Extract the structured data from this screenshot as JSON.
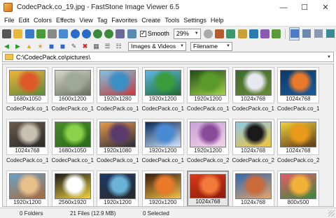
{
  "window": {
    "title": "CodecPack.co_19.jpg - FastStone Image Viewer 6.5"
  },
  "menu": [
    "File",
    "Edit",
    "Colors",
    "Effects",
    "View",
    "Tag",
    "Favorites",
    "Create",
    "Tools",
    "Settings",
    "Help"
  ],
  "toolbar": {
    "smooth_label": "Smooth",
    "smooth_checked": true,
    "zoom_value": "29%"
  },
  "browser": {
    "filter_value": "Images & Videos",
    "sort_value": "Filename",
    "path": "C:\\CodecPack.co\\pictures\\"
  },
  "thumbnails": [
    {
      "dim": "1680x1050",
      "name": "CodecPack.co_1",
      "colors": [
        "#f2b23a",
        "#e0582a",
        "#5c8a3a"
      ]
    },
    {
      "dim": "1600x1200",
      "name": "CodecPack.co_10",
      "colors": [
        "#d8d8c8",
        "#a0a898",
        "#6a7060"
      ]
    },
    {
      "dim": "1920x1280",
      "name": "CodecPack.co_11",
      "colors": [
        "#7cc4e8",
        "#3b8fc7",
        "#c83a3a"
      ]
    },
    {
      "dim": "1920x1200",
      "name": "CodecPack.co_12",
      "colors": [
        "#5db7e6",
        "#3a9c3a",
        "#1f6b2b"
      ]
    },
    {
      "dim": "1920x1200",
      "name": "CodecPack.co_13",
      "colors": [
        "#1f4d14",
        "#5a9a2a",
        "#9fd24a"
      ]
    },
    {
      "dim": "1024x768",
      "name": "CodecPack.co_14",
      "colors": [
        "#3a6a2a",
        "#e8e8f0",
        "#6a8a3a"
      ]
    },
    {
      "dim": "1024x768",
      "name": "CodecPack.co_15",
      "colors": [
        "#0a3a6a",
        "#e87a2a",
        "#1a5a9a"
      ]
    },
    {
      "dim": "1024x768",
      "name": "CodecPack.co_16",
      "colors": [
        "#6a5a4a",
        "#c8c0b0",
        "#2a2a2a"
      ]
    },
    {
      "dim": "1680x1050",
      "name": "CodecPack.co_17",
      "colors": [
        "#4a8a2a",
        "#8ad24a",
        "#2a6a1a"
      ]
    },
    {
      "dim": "1920x1080",
      "name": "CodecPack.co_18",
      "colors": [
        "#e89a4a",
        "#5a3a6a",
        "#2a2a3a"
      ]
    },
    {
      "dim": "1920x1200",
      "name": "CodecPack.co_19",
      "colors": [
        "#0a2a5a",
        "#4a8ad2",
        "#cfe6ff"
      ]
    },
    {
      "dim": "1920x1200",
      "name": "CodecPack.co_2",
      "colors": [
        "#c8a0d8",
        "#8a4a9a",
        "#f2d2e6"
      ]
    },
    {
      "dim": "1024x768",
      "name": "CodecPack.co_20",
      "colors": [
        "#8acbe8",
        "#1a1a1a",
        "#f2c23a"
      ]
    },
    {
      "dim": "1024x768",
      "name": "CodecPack.co_21",
      "colors": [
        "#f2d23a",
        "#e89a1a",
        "#5a3a1a"
      ]
    },
    {
      "dim": "1920x1200",
      "name": "CodecPack.co_22",
      "colors": [
        "#6aa2c8",
        "#e8c08a",
        "#a86a3a"
      ]
    },
    {
      "dim": "2560x1920",
      "name": "CodecPack.co_23",
      "colors": [
        "#1a1a1a",
        "#ffffff",
        "#f2d23a"
      ]
    },
    {
      "dim": "1920x1200",
      "name": "CodecPack.co_24",
      "colors": [
        "#1a3a6a",
        "#6ab2d8",
        "#2a2a2a"
      ]
    },
    {
      "dim": "1920x1200",
      "name": "CodecPack.co_25",
      "colors": [
        "#3a1a0a",
        "#e87a2a",
        "#f2c24a"
      ]
    },
    {
      "dim": "1024x768",
      "name": "CodecPack.co_26",
      "colors": [
        "#d83a1a",
        "#f27a3a",
        "#8a1a0a"
      ],
      "selected": true
    },
    {
      "dim": "1024x768",
      "name": "CodecPack.co_27",
      "colors": [
        "#2a6ab2",
        "#c86a3a",
        "#e8a26a"
      ]
    },
    {
      "dim": "800x500",
      "name": "CodecPack.co_28",
      "colors": [
        "#e85a6a",
        "#f2b23a",
        "#3a8a3a"
      ]
    }
  ],
  "status": {
    "folders": "0 Folders",
    "files": "21 Files (12.9 MB)",
    "selected": "0 Selected"
  }
}
